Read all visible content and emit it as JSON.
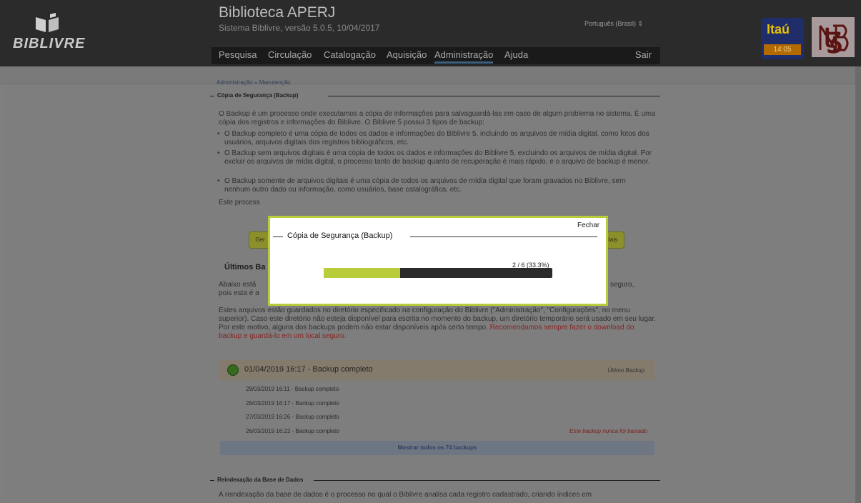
{
  "header": {
    "logo_text": "BIBLIVRE",
    "title": "Biblioteca APERJ",
    "subtitle": "Sistema Biblivre, versão 5.0.5, 10/04/2017",
    "language": "Português (Brasil) ⇕",
    "menu": [
      "Pesquisa",
      "Circulação",
      "Catalogação",
      "Aquisição",
      "Administração",
      "Ajuda"
    ],
    "active_menu": "Administração",
    "logout": "Sair",
    "itau": {
      "name": "Itaú",
      "time": "14:05"
    }
  },
  "breadcrumb": "Administração » Manutenção",
  "backup_section": {
    "title": "Cópia de Segurança (Backup)",
    "intro": "O Backup é um processo onde executamos a cópia de informações para salvaguardá-las em caso de algum problema no sistema. É uma cópia dos registros e informações do Biblivre. O Biblivre 5 possui 3 tipos de backup:",
    "bullets": [
      "O Backup completo é uma cópia de todos os dados e informações do Biblivre 5, incluindo os arquivos de mídia digital, como fotos dos usuários, arquivos digitais dos registros bibliográficos, etc.",
      "O Backup sem arquivos digitais é uma cópia de todos os dados e informações do Biblivre 5, excluindo os arquivos de mídia digital. Por excluir os arquivos de mídia digital, o processo tanto de backup quanto de recuperação é mais rápido, e o arquivo de backup é menor.",
      "O Backup somente de arquivos digitais é uma cópia de todos os arquivos de mídia digital que foram gravados no Biblivre, sem nenhum outro dado ou informação, como usuários, base catalográfica, etc."
    ],
    "process_text": "Este process",
    "button_left": "Ger",
    "button_right": "itais",
    "last_backups_title": "Últimos Ba",
    "last_text_1": "Abaixo estã",
    "last_text_2": "pois esta é a",
    "last_text_right": "seguro,",
    "storage_text": "Estes arquivos estão guardados no diretório especificado na configuração do Biblivre (\"Administração\", \"Configurações\", no menu superior). Caso este diretório não esteja disponível para escrita no momento do backup, um diretório temporário será usado em seu lugar. Por este motivo, alguns dos backups podem não estar disponíveis após certo tempo.",
    "storage_warning": "Recomendamos sempre fazer o download do backup e guardá-lo em um local seguro.",
    "latest": {
      "label": "01/04/2019 16:17 - Backup completo",
      "tag": "Último Backup"
    },
    "older": [
      "29/03/2019 16:11 - Backup completo",
      "28/03/2019 16:17 - Backup completo",
      "27/03/2019 16:26 - Backup completo",
      "26/03/2019 16:22 - Backup completo"
    ],
    "older_warning": "Este backup nunca foi baixado",
    "show_all": "Mostrar todos os 74 backups"
  },
  "reindex_section": {
    "title": "Reindexação da Base de Dados",
    "text": "A reindexação da base de dados é o processo no qual o Biblivre analisa cada registro cadastrado, criando índices em"
  },
  "modal": {
    "close": "Fechar",
    "title": "Cópia de Segurança (Backup)",
    "progress_label": "2 / 6 (33.3%)",
    "progress_fraction": 0.333
  }
}
